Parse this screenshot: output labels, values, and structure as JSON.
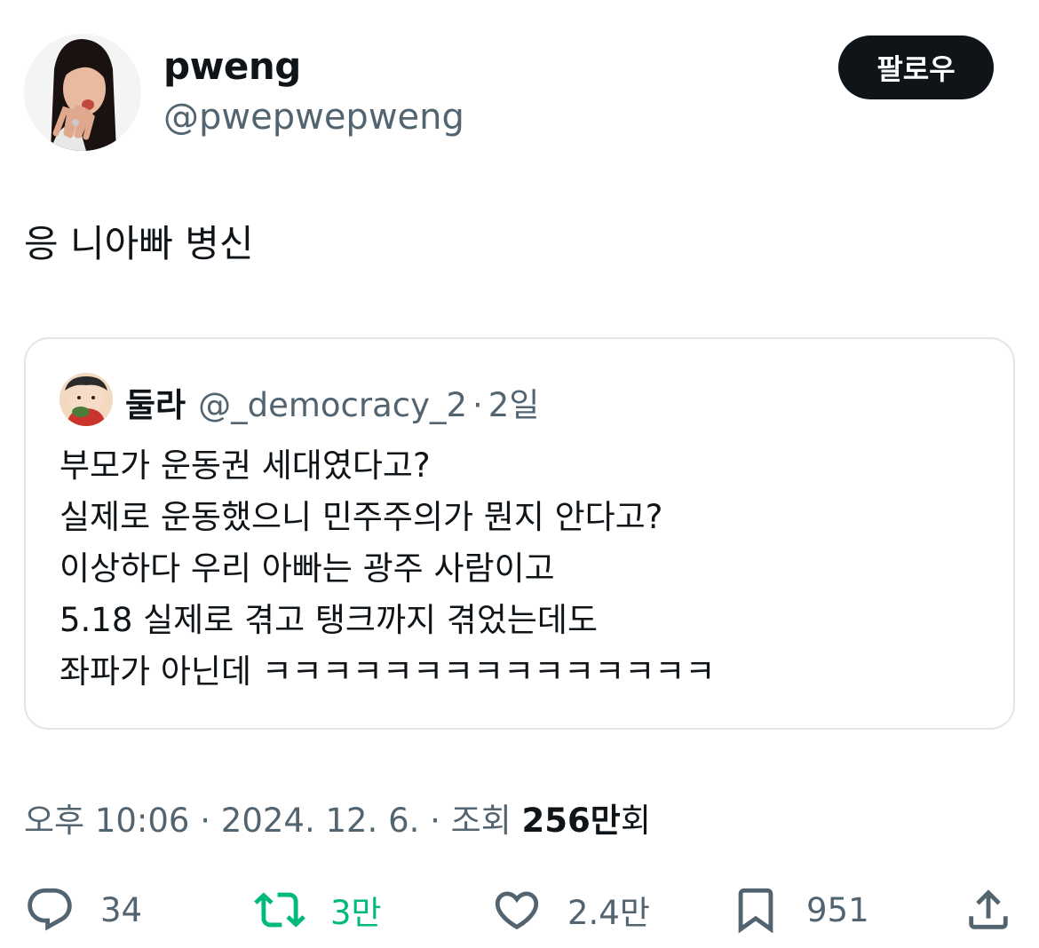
{
  "author": {
    "display_name": "pweng",
    "handle": "@pwepwepweng",
    "follow_label": "팔로우"
  },
  "tweet": {
    "text": "응 니아빠 병신"
  },
  "quote": {
    "display_name": "둘라",
    "handle": "@_democracy_2",
    "separator": "·",
    "time": "2일",
    "lines": [
      "부모가 운동권 세대였다고?",
      "실제로 운동했으니 민주주의가 뭔지 안다고?",
      "이상하다 우리 아빠는 광주 사람이고",
      "5.18 실제로 겪고 탱크까지 겪었는데도",
      "좌파가 아닌데 ㅋㅋㅋㅋㅋㅋㅋㅋㅋㅋㅋㅋㅋㅋㅋ"
    ]
  },
  "meta": {
    "time": "오후 10:06",
    "sep1": "·",
    "date": "2024. 12. 6.",
    "sep2": "·",
    "views_prefix": "조회",
    "views_count": "256만",
    "views_suffix": "회"
  },
  "actions": {
    "replies": "34",
    "retweets": "3만",
    "likes": "2.4만",
    "bookmarks": "951"
  },
  "colors": {
    "text": "#0f1419",
    "secondary": "#536471",
    "border": "#e1e6ea",
    "retweet_green": "#00ba7c",
    "button_bg": "#0f1419"
  },
  "icons": [
    "reply-icon",
    "retweet-icon",
    "like-icon",
    "bookmark-icon",
    "share-icon"
  ]
}
